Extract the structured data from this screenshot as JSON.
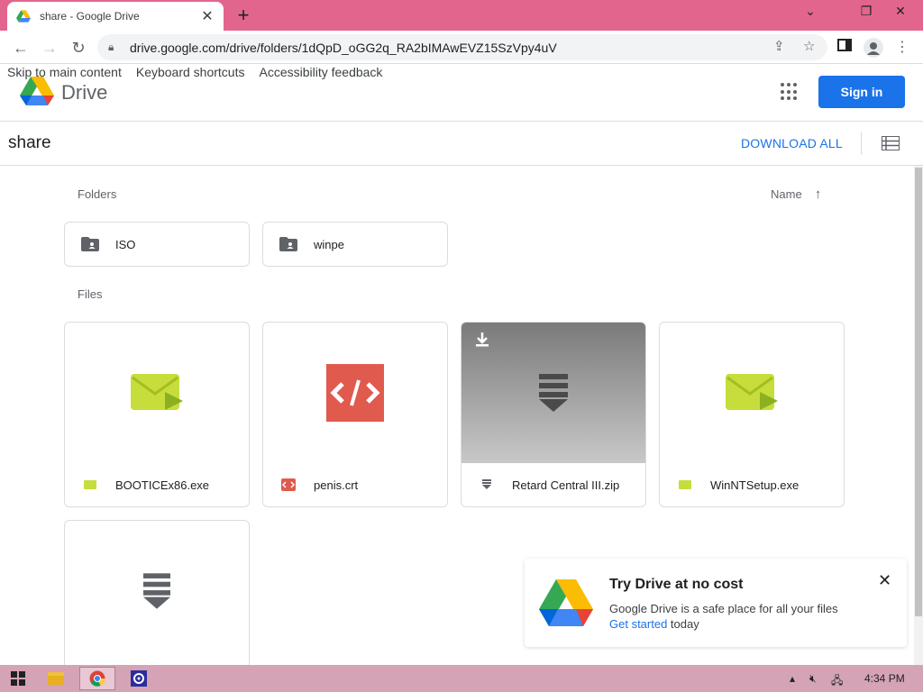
{
  "browser": {
    "tab_title": "share - Google Drive",
    "tab_close": "✕",
    "new_tab": "+",
    "url": "drive.google.com/drive/folders/1dQpD_oGG2q_RA2bIMAwEVZ15SzVpy4uV",
    "window_controls": {
      "minimize": "⌄",
      "restore": "❐",
      "close": "✕"
    },
    "accent": "#e2658e"
  },
  "skip_links": [
    "Skip to main content",
    "Keyboard shortcuts",
    "Accessibility feedback"
  ],
  "header": {
    "app_name": "Drive",
    "sign_in": "Sign in",
    "sign_in_color": "#1a73e8"
  },
  "toolbar": {
    "folder_name": "share",
    "download_all": "DOWNLOAD ALL"
  },
  "folders_section": {
    "label": "Folders",
    "sort_label": "Name",
    "items": [
      {
        "name": "ISO"
      },
      {
        "name": "winpe"
      }
    ]
  },
  "files_section": {
    "label": "Files",
    "items": [
      {
        "name": "BOOTICEx86.exe",
        "icon": "exe-icon"
      },
      {
        "name": "penis.crt",
        "icon": "code-icon"
      },
      {
        "name": "Retard Central III.zip",
        "icon": "archive-icon"
      },
      {
        "name": "WinNTSetup.exe",
        "icon": "exe-icon"
      },
      {
        "name": "",
        "icon": "archive-icon"
      }
    ]
  },
  "promo": {
    "title": "Try Drive at no cost",
    "description": "Google Drive is a safe place for all your files",
    "link_text": "Get started",
    "link_suffix": " today",
    "close": "✕"
  },
  "taskbar": {
    "time": "4:34 PM"
  }
}
